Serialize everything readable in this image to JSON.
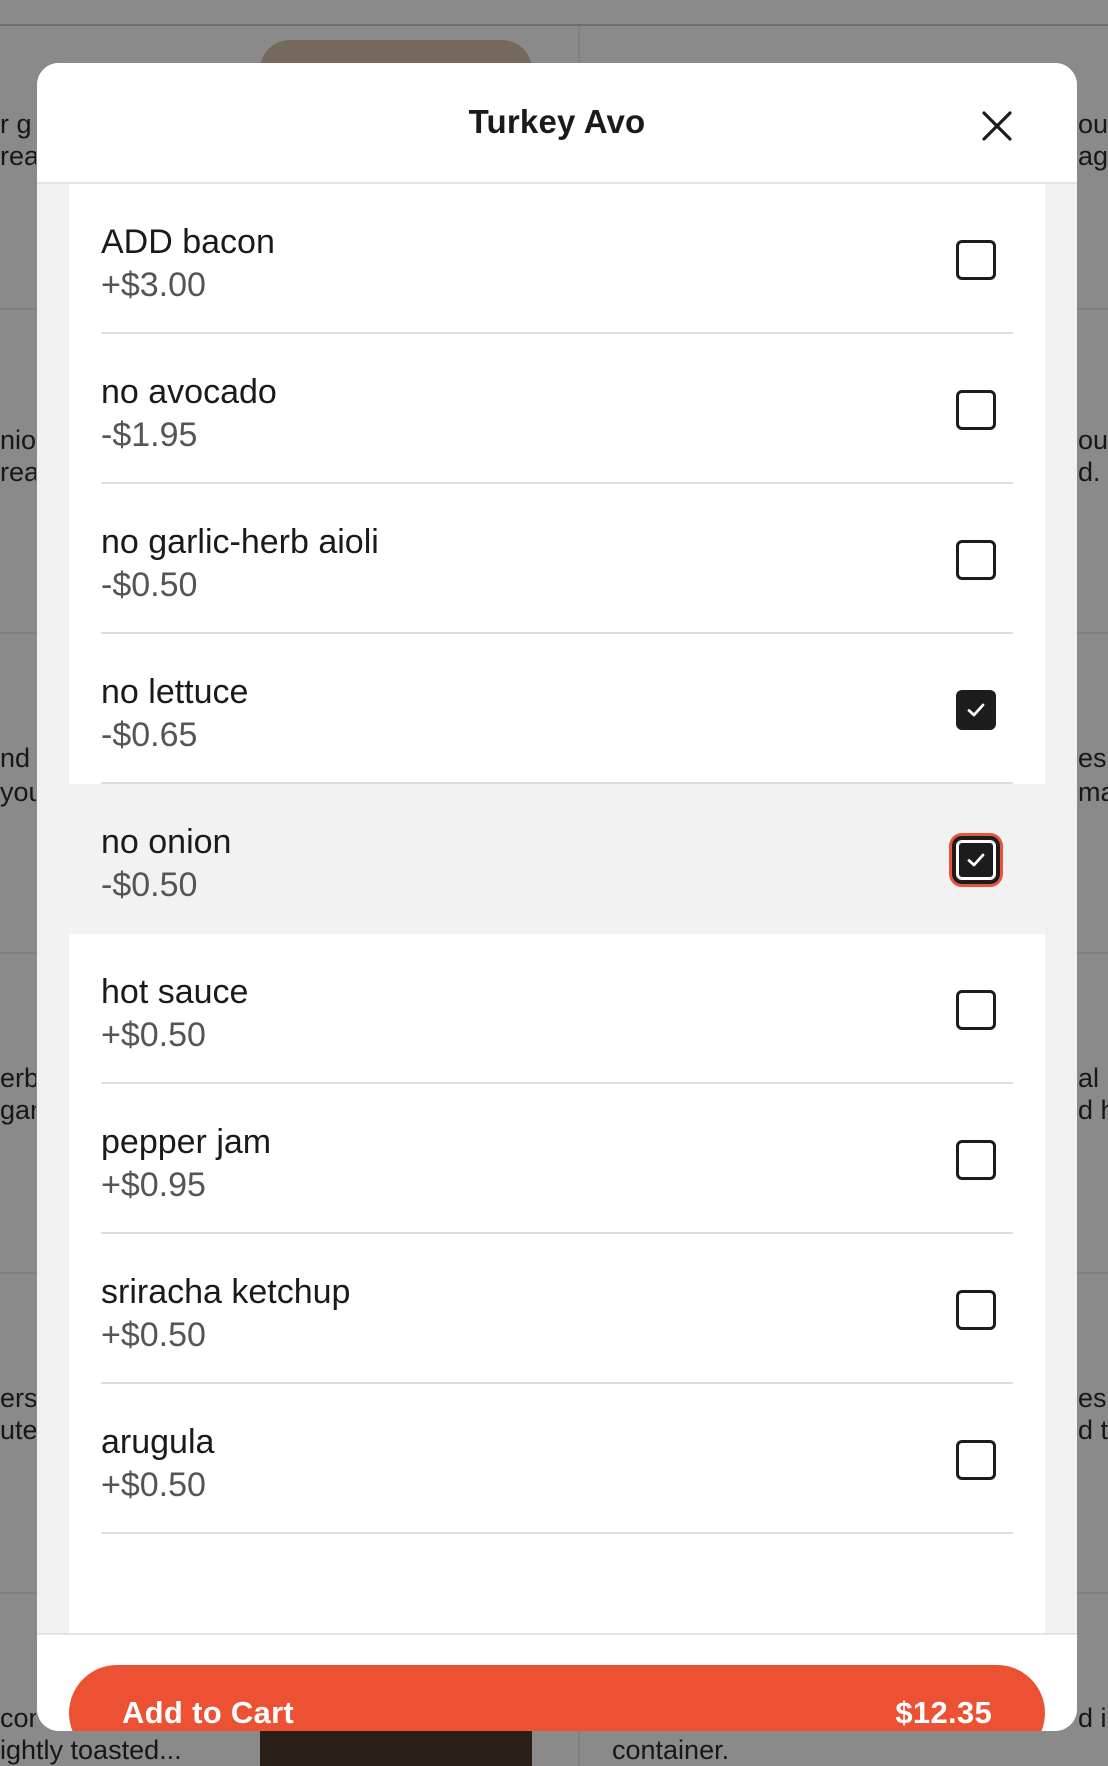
{
  "modal": {
    "title": "Turkey Avo",
    "close_icon": "close-icon"
  },
  "options": [
    {
      "name": "ADD bacon",
      "price": "+$3.00",
      "checked": false
    },
    {
      "name": "no avocado",
      "price": "-$1.95",
      "checked": false
    },
    {
      "name": "no garlic-herb aioli",
      "price": "-$0.50",
      "checked": false
    },
    {
      "name": "no lettuce",
      "price": "-$0.65",
      "checked": true
    },
    {
      "name": "no onion",
      "price": "-$0.50",
      "checked": true,
      "focused": true,
      "highlighted": true
    },
    {
      "name": "hot sauce",
      "price": "+$0.50",
      "checked": false
    },
    {
      "name": "pepper jam",
      "price": "+$0.95",
      "checked": false
    },
    {
      "name": "sriracha ketchup",
      "price": "+$0.50",
      "checked": false
    },
    {
      "name": "arugula",
      "price": "+$0.50",
      "checked": false
    }
  ],
  "footer": {
    "add_label": "Add to Cart",
    "total": "$12.35"
  },
  "background": {
    "left_snippets": [
      "r g",
      "rea",
      "nio",
      "rea",
      "nd",
      "you",
      "erb",
      "gan",
      "ers",
      "ute",
      "con",
      "ightly toasted..."
    ],
    "right_snippets": [
      "ou",
      "ag",
      "ou",
      "d.",
      "es",
      "ma",
      "al l",
      "d h",
      "es,",
      "d t",
      "d in",
      "container."
    ]
  },
  "colors": {
    "accent": "#ec5134",
    "focus_ring": "#e8553a",
    "checkbox_fill": "#1c1c1c"
  }
}
